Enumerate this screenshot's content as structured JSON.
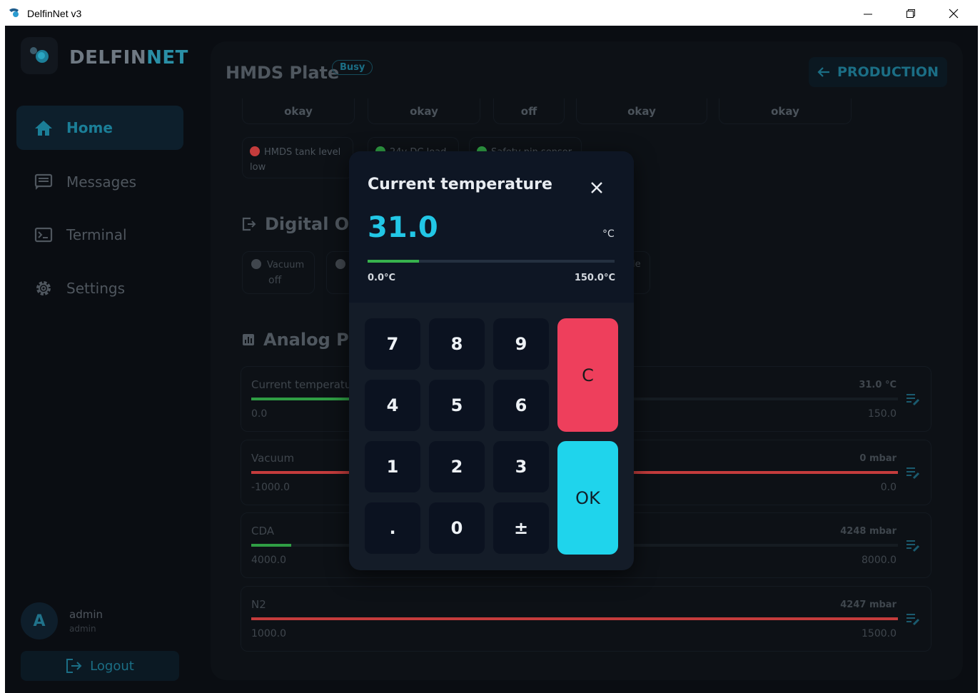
{
  "window": {
    "title": "DelfinNet v3",
    "minimize_icon": "minimize-icon",
    "restore_icon": "restore-icon",
    "close_icon": "close-icon"
  },
  "brand": {
    "prefix": "DELFIN",
    "suffix": "NET",
    "accent": "#2a8fa6"
  },
  "sidebar": {
    "items": [
      {
        "label": "Home",
        "icon": "home-icon",
        "active": true
      },
      {
        "label": "Messages",
        "icon": "messages-icon",
        "active": false
      },
      {
        "label": "Terminal",
        "icon": "terminal-icon",
        "active": false
      },
      {
        "label": "Settings",
        "icon": "gear-icon",
        "active": false
      }
    ],
    "user": {
      "initial": "A",
      "name": "admin",
      "role": "admin"
    },
    "logout_label": "Logout"
  },
  "header": {
    "title": "HMDS Plate",
    "badge": "Busy",
    "production_label": "PRODUCTION"
  },
  "status_row": [
    "okay",
    "okay",
    "off",
    "okay",
    "okay"
  ],
  "sensors": [
    {
      "line1": "HMDS tank level",
      "line2": "low",
      "color": "#c43c3c"
    },
    {
      "line1": "24v DC load",
      "line2": "",
      "color": "#2f9e44"
    },
    {
      "line1": "Safety pin sensor",
      "line2": "",
      "color": "#2f9e44"
    }
  ],
  "digital_outputs": {
    "title": "Digital Ou",
    "items": [
      {
        "label": "Vacuum",
        "state": "off"
      },
      {
        "label": "",
        "state": ""
      }
    ],
    "right_fragment": "le"
  },
  "analog": {
    "title": "Analog Pa",
    "items": [
      {
        "name": "Current temperatu",
        "value": "31.0 °C",
        "min": "0.0",
        "max": "150.0",
        "fraction": 0.207,
        "color": "#2f9e44"
      },
      {
        "name": "Vacuum",
        "value": "0 mbar",
        "min": "-1000.0",
        "max": "0.0",
        "fraction": 1.0,
        "color": "#c43c3c"
      },
      {
        "name": "CDA",
        "value": "4248 mbar",
        "min": "4000.0",
        "max": "8000.0",
        "fraction": 0.062,
        "color": "#2f9e44"
      },
      {
        "name": "N2",
        "value": "4247 mbar",
        "min": "1000.0",
        "max": "1500.0",
        "fraction": 1.0,
        "color": "#c43c3c"
      }
    ]
  },
  "modal": {
    "title": "Current temperature",
    "value": "31.0",
    "unit": "°C",
    "min_label": "0.0°C",
    "max_label": "150.0°C",
    "fraction": 0.207,
    "keys": [
      "7",
      "8",
      "9",
      "4",
      "5",
      "6",
      "1",
      "2",
      "3",
      ".",
      "0",
      "±"
    ],
    "clear_label": "C",
    "ok_label": "OK",
    "colors": {
      "value": "#22c7e6",
      "clear": "#ee3f5c",
      "ok": "#1fd4ec",
      "fill": "#37b24d"
    }
  }
}
